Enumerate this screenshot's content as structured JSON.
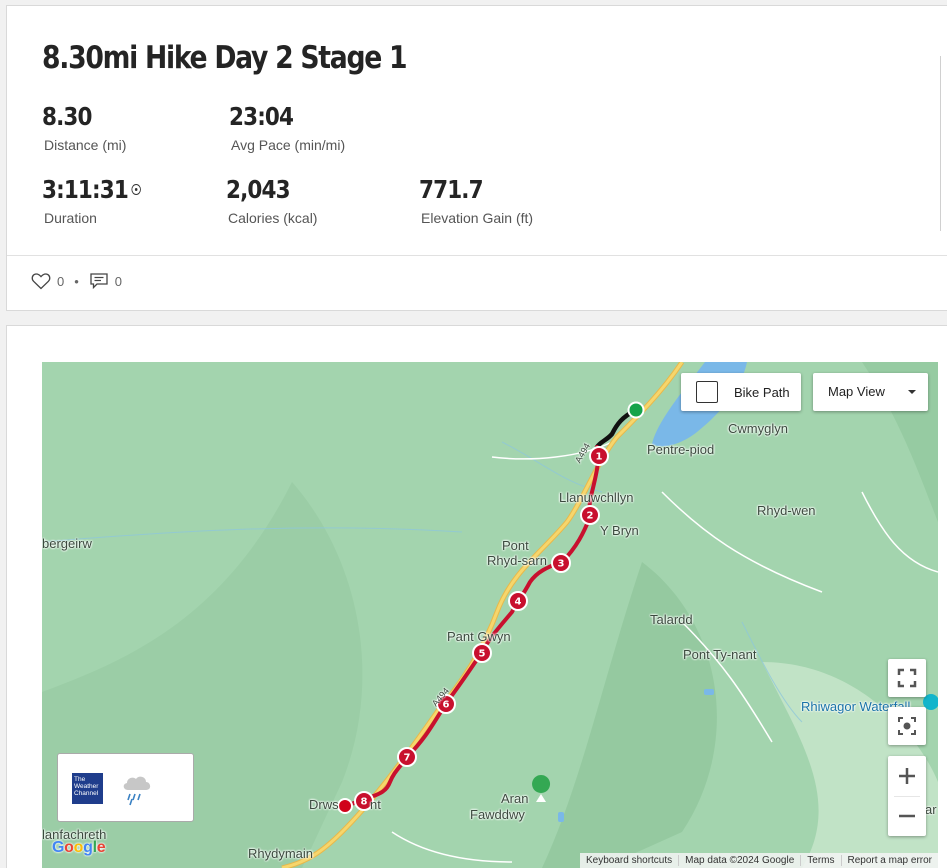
{
  "activity": {
    "title": "8.30mi Hike Day 2 Stage 1",
    "stats": [
      {
        "value": "8.30",
        "label": "Distance (mi)"
      },
      {
        "value": "23:04",
        "label": "Avg Pace (min/mi)"
      },
      {
        "value": "3:11:31",
        "label": "Duration"
      },
      {
        "value": "2,043",
        "label": "Calories (kcal)"
      },
      {
        "value": "771.7",
        "label": "Elevation Gain (ft)"
      }
    ]
  },
  "social": {
    "likes": "0",
    "separator": "•",
    "comments": "0"
  },
  "map": {
    "bike_path_label": "Bike Path",
    "map_view_label": "Map View",
    "places": {
      "cwmyglyn": "Cwmyglyn",
      "pentre_piod": "Pentre-piod",
      "llanuwchllyn": "Llanuwchllyn",
      "rhyd_wen": "Rhyd-wen",
      "y_bryn": "Y Bryn",
      "bergeirw": "bergeirw",
      "pont": "Pont",
      "rhyd_sarn": "Rhyd-sarn",
      "talardd": "Talardd",
      "pont_ty_nant": "Pont Ty-nant",
      "pant_gwyn": "Pant Gwyn",
      "rhiwagor": "Rhiwagor Waterfall",
      "drws": "Drws",
      "nt": "nt",
      "aran": "Aran",
      "fawddwy": "Fawddwy",
      "llanfachreth": "lanfachreth",
      "rhydymain": "Rhydymain",
      "road": "A494",
      "far_right": "ar"
    },
    "mile_markers": [
      "1",
      "2",
      "3",
      "4",
      "5",
      "6",
      "7",
      "8"
    ],
    "weather_logo": "The Weather Channel",
    "google_logo": "Google",
    "attribution": [
      "Keyboard shortcuts",
      "Map data ©2024 Google",
      "Terms",
      "Report a map error"
    ],
    "colors": {
      "route": "#c8102e",
      "start": "#16a34a",
      "water": "#7ab8e8",
      "land": "#9fd2ab",
      "road": "#f2c94c"
    }
  }
}
